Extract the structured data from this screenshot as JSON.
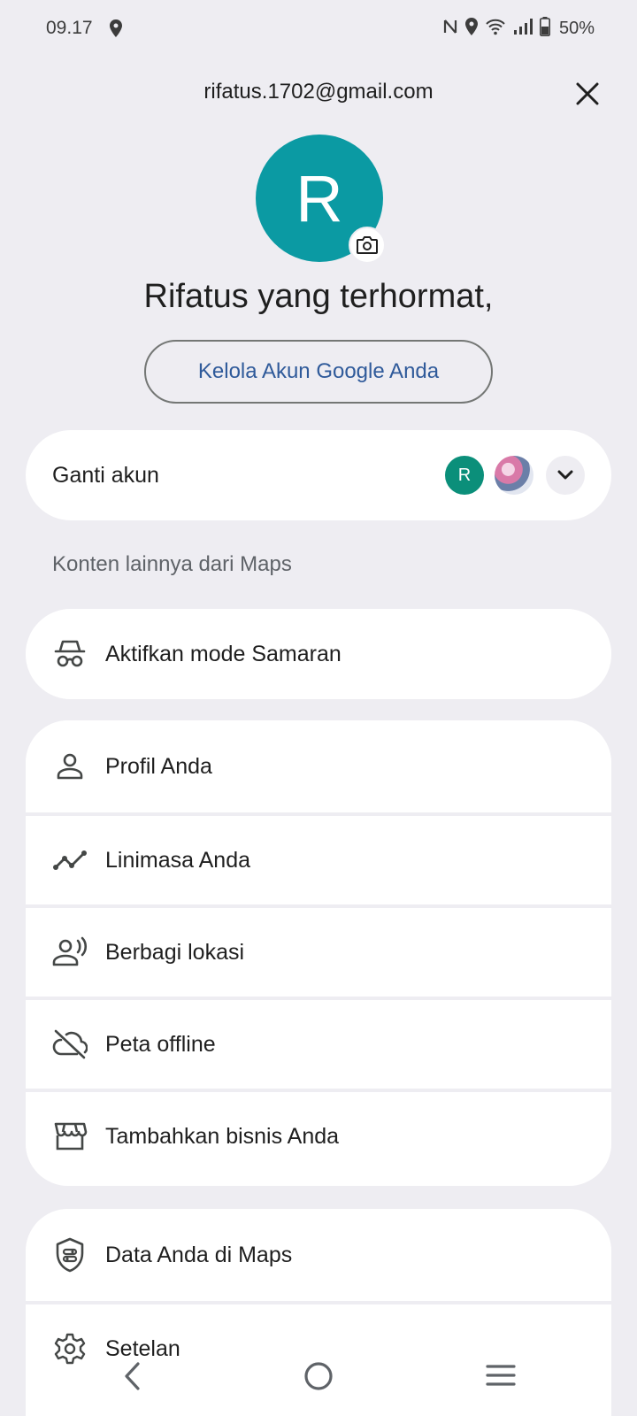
{
  "status_bar": {
    "time": "09.17",
    "battery": "50%",
    "icons": [
      "location-icon",
      "nfc-icon",
      "wifi-icon",
      "signal-icon",
      "battery-icon"
    ]
  },
  "header": {
    "email": "rifatus.1702@gmail.com",
    "avatar_letter": "R",
    "greeting": "Rifatus yang terhormat,",
    "manage_button": "Kelola Akun Google Anda"
  },
  "switch_account": {
    "label": "Ganti akun",
    "accounts": [
      {
        "letter": "R",
        "color": "#0b8f7a"
      },
      {
        "letter": "",
        "type": "photo"
      }
    ]
  },
  "section": {
    "label": "Konten lainnya dari Maps"
  },
  "incognito": {
    "label": "Aktifkan mode Samaran",
    "icon": "incognito-icon"
  },
  "menu_items": [
    {
      "label": "Profil Anda",
      "icon": "person-icon"
    },
    {
      "label": "Linimasa Anda",
      "icon": "timeline-icon"
    },
    {
      "label": "Berbagi lokasi",
      "icon": "location-sharing-icon"
    },
    {
      "label": "Peta offline",
      "icon": "cloud-off-icon"
    },
    {
      "label": "Tambahkan bisnis Anda",
      "icon": "storefront-icon"
    }
  ],
  "bottom_items": [
    {
      "label": "Data Anda di Maps",
      "icon": "shield-icon"
    },
    {
      "label": "Setelan",
      "icon": "gear-icon"
    }
  ],
  "colors": {
    "background": "#eeedf2",
    "avatar": "#0b9aa3",
    "link": "#2f5a9a"
  }
}
